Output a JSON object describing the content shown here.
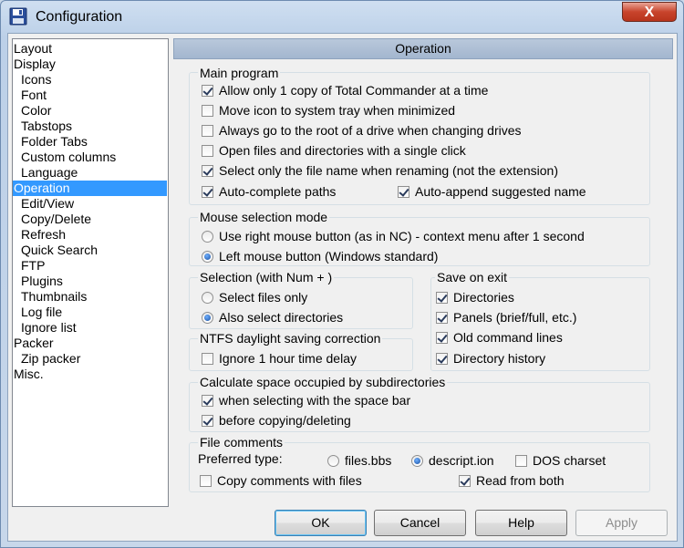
{
  "window": {
    "title": "Configuration",
    "close_label": "X"
  },
  "tree": {
    "items": [
      {
        "label": "Layout",
        "indent": 0
      },
      {
        "label": "Display",
        "indent": 0
      },
      {
        "label": "Icons",
        "indent": 1
      },
      {
        "label": "Font",
        "indent": 1
      },
      {
        "label": "Color",
        "indent": 1
      },
      {
        "label": "Tabstops",
        "indent": 1
      },
      {
        "label": "Folder Tabs",
        "indent": 1
      },
      {
        "label": "Custom columns",
        "indent": 1
      },
      {
        "label": "Language",
        "indent": 1
      },
      {
        "label": "Operation",
        "indent": 0,
        "selected": true
      },
      {
        "label": "Edit/View",
        "indent": 1
      },
      {
        "label": "Copy/Delete",
        "indent": 1
      },
      {
        "label": "Refresh",
        "indent": 1
      },
      {
        "label": "Quick Search",
        "indent": 1
      },
      {
        "label": "FTP",
        "indent": 1
      },
      {
        "label": "Plugins",
        "indent": 1
      },
      {
        "label": "Thumbnails",
        "indent": 1
      },
      {
        "label": "Log file",
        "indent": 1
      },
      {
        "label": "Ignore list",
        "indent": 1
      },
      {
        "label": "Packer",
        "indent": 0
      },
      {
        "label": "Zip packer",
        "indent": 1
      },
      {
        "label": "Misc.",
        "indent": 0
      }
    ]
  },
  "panel": {
    "header": "Operation"
  },
  "main_program": {
    "title": "Main program",
    "allow_one_copy": {
      "label": "Allow only 1 copy of Total Commander at a time",
      "checked": true
    },
    "move_icon_tray": {
      "label": "Move icon to system tray when minimized",
      "checked": false
    },
    "go_to_root": {
      "label": "Always go to the root of a drive when changing drives",
      "checked": false
    },
    "single_click": {
      "label": "Open files and directories with a single click",
      "checked": false
    },
    "select_name_only": {
      "label": "Select only the file name when renaming (not the extension)",
      "checked": true
    },
    "auto_complete": {
      "label": "Auto-complete paths",
      "checked": true
    },
    "auto_append": {
      "label": "Auto-append suggested name",
      "checked": true
    }
  },
  "mouse_mode": {
    "title": "Mouse selection mode",
    "right_button": {
      "label": "Use right mouse button (as in NC) - context menu after 1 second",
      "checked": false
    },
    "left_button": {
      "label": "Left mouse button (Windows standard)",
      "checked": true
    }
  },
  "selection": {
    "title": "Selection (with Num + )",
    "files_only": {
      "label": "Select files only",
      "checked": false
    },
    "also_dirs": {
      "label": "Also select directories",
      "checked": true
    }
  },
  "save_on_exit": {
    "title": "Save on exit",
    "directories": {
      "label": "Directories",
      "checked": true
    },
    "panels": {
      "label": "Panels (brief/full, etc.)",
      "checked": true
    },
    "old_cmd": {
      "label": "Old command lines",
      "checked": true
    },
    "dir_history": {
      "label": "Directory history",
      "checked": true
    }
  },
  "ntfs": {
    "title": "NTFS daylight saving correction",
    "ignore_hour": {
      "label": "Ignore 1 hour time delay",
      "checked": false
    }
  },
  "calc_space": {
    "title": "Calculate space occupied by subdirectories",
    "space_bar": {
      "label": "when selecting with the space bar",
      "checked": true
    },
    "before_copy": {
      "label": "before copying/deleting",
      "checked": true
    }
  },
  "file_comments": {
    "title": "File comments",
    "preferred_type_label": "Preferred type:",
    "files_bbs": {
      "label": "files.bbs",
      "checked": false
    },
    "descript_ion": {
      "label": "descript.ion",
      "checked": true
    },
    "dos_charset": {
      "label": "DOS charset",
      "checked": false
    },
    "copy_comments": {
      "label": "Copy comments with files",
      "checked": false
    },
    "read_both": {
      "label": "Read from both",
      "checked": true
    }
  },
  "buttons": {
    "ok": "OK",
    "cancel": "Cancel",
    "help": "Help",
    "apply": "Apply"
  }
}
